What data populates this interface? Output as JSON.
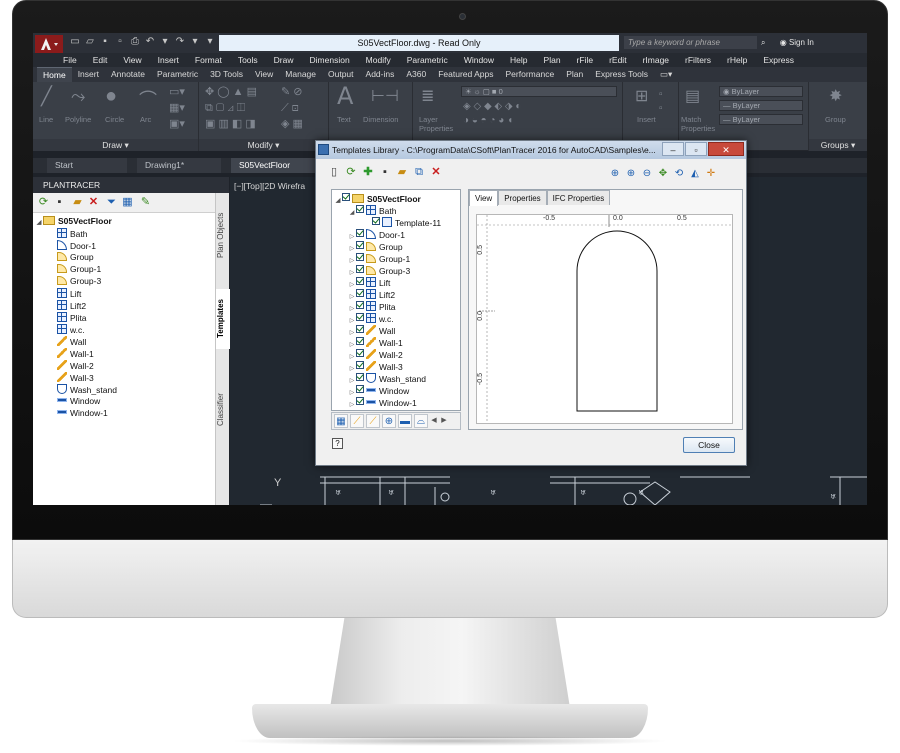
{
  "app": {
    "window_title": "S05VectFloor.dwg - Read Only",
    "search_placeholder": "Type a keyword or phrase",
    "sign_in": "Sign In"
  },
  "menu": [
    "File",
    "Edit",
    "View",
    "Insert",
    "Format",
    "Tools",
    "Draw",
    "Dimension",
    "Modify",
    "Parametric",
    "Window",
    "Help",
    "Plan",
    "rFile",
    "rEdit",
    "rImage",
    "rFilters",
    "rHelp",
    "Express"
  ],
  "ribbon_tabs": [
    "Home",
    "Insert",
    "Annotate",
    "Parametric",
    "3D Tools",
    "View",
    "Manage",
    "Output",
    "Add-ins",
    "A360",
    "Featured Apps",
    "Performance",
    "Plan",
    "Express Tools"
  ],
  "ribbon": {
    "draw_group": "Draw",
    "modify_group": "Modify",
    "groups_group": "Groups",
    "line": "Line",
    "polyline": "Polyline",
    "circle": "Circle",
    "arc": "Arc",
    "text": "Text",
    "dimension": "Dimension",
    "layer_properties": "Layer\nProperties",
    "insert": "Insert",
    "match_properties": "Match\nProperties",
    "group": "Group",
    "bylayer1": "ByLayer",
    "bylayer2": "ByLayer",
    "bylayer3": "ByLayer",
    "layer_value": "0"
  },
  "doc_tabs": [
    "Start",
    "Drawing1*",
    "S05VectFloor"
  ],
  "palette": {
    "title": "PLANTRACER",
    "root": "S05VectFloor",
    "items": [
      "Bath",
      "Door-1",
      "Group",
      "Group-1",
      "Group-3",
      "Lift",
      "Lift2",
      "Plita",
      "w.c.",
      "Wall",
      "Wall-1",
      "Wall-2",
      "Wall-3",
      "Wash_stand",
      "Window",
      "Window-1"
    ],
    "side_tabs": [
      "Plan Objects",
      "Templates",
      "Classifier"
    ]
  },
  "viewport": {
    "label": "[−][Top][2D Wirefra",
    "ucs_y": "Y"
  },
  "dialog": {
    "title": "Templates Library - C:\\ProgramData\\CSoft\\PlanTracer 2016 for AutoCAD\\Samples\\e...",
    "root": "S05VectFloor",
    "template_item": "Template-11",
    "items": [
      "Bath",
      "Door-1",
      "Group",
      "Group-1",
      "Group-3",
      "Lift",
      "Lift2",
      "Plita",
      "w.c.",
      "Wall",
      "Wall-1",
      "Wall-2",
      "Wall-3",
      "Wash_stand",
      "Window",
      "Window-1"
    ],
    "tabs": [
      "View",
      "Properties",
      "IFC Properties"
    ],
    "ruler_x": [
      "-0.5",
      "0.0",
      "0.5"
    ],
    "ruler_y": [
      "0.5",
      "0.0",
      "-0.5"
    ],
    "close_label": "Close",
    "help_label": "?"
  }
}
